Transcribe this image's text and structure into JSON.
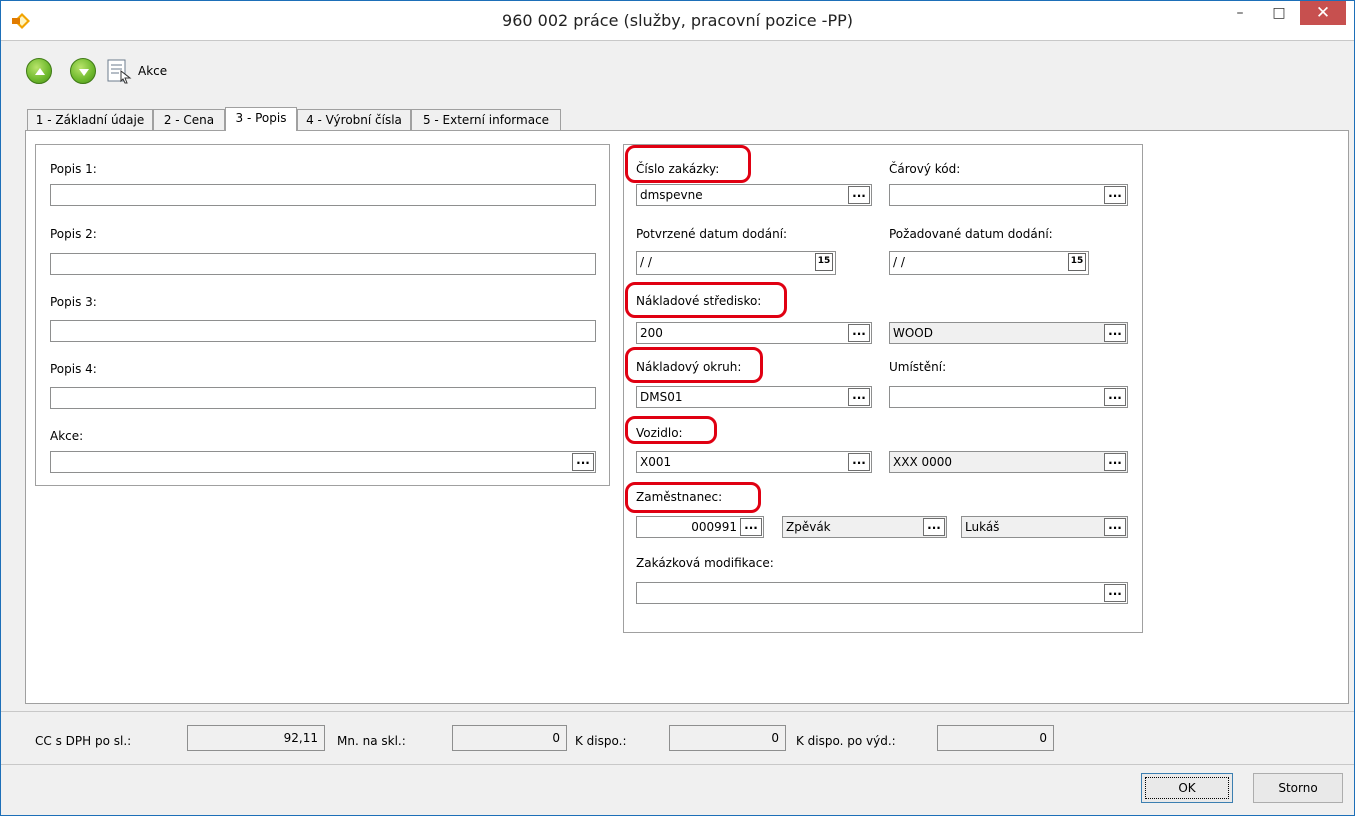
{
  "window": {
    "title": "960 002 práce (služby, pracovní pozice -PP)",
    "min_symbol": "–",
    "max_symbol": "□",
    "close_symbol": "✕",
    "accent": "#c7504f"
  },
  "toolbar": {
    "akce_label": "Akce"
  },
  "tabs": [
    {
      "label": "1 - Základní údaje"
    },
    {
      "label": "2 - Cena"
    },
    {
      "label": "3 - Popis"
    },
    {
      "label": "4 - Výrobní čísla"
    },
    {
      "label": "5 - Externí informace"
    }
  ],
  "left": {
    "popis1_label": "Popis 1:",
    "popis1_value": "",
    "popis2_label": "Popis 2:",
    "popis2_value": "",
    "popis3_label": "Popis 3:",
    "popis3_value": "",
    "popis4_label": "Popis 4:",
    "popis4_value": "",
    "akce_label": "Akce:",
    "akce_value": ""
  },
  "right": {
    "cislo_zakazky_label": "Číslo zakázky:",
    "cislo_zakazky_value": "dmspevne",
    "carovy_kod_label": "Čárový kód:",
    "carovy_kod_value": "",
    "potvrzene_label": "Potvrzené datum dodání:",
    "potvrzene_value": "/ /",
    "pozadovane_label": "Požadované datum dodání:",
    "pozadovane_value": "/ /",
    "calendar_glyph": "15",
    "stredisko_label": "Nákladové středisko:",
    "stredisko_value": "200",
    "stredisko_name": "WOOD",
    "okruh_label": "Nákladový okruh:",
    "okruh_value": "DMS01",
    "umisteni_label": "Umístění:",
    "umisteni_value": "",
    "vozidlo_label": "Vozidlo:",
    "vozidlo_value": "X001",
    "vozidlo_spz": "XXX 0000",
    "zamestnanec_label": "Zaměstnanec:",
    "zamestnanec_code": "000991",
    "zamestnanec_surname": "Zpěvák",
    "zamestnanec_firstname": "Lukáš",
    "modifikace_label": "Zakázková modifikace:",
    "modifikace_value": ""
  },
  "ellipsis": "...",
  "status": {
    "cc_label": "CC s DPH po sl.:",
    "cc_value": "92,11",
    "mn_label": "Mn. na skl.:",
    "mn_value": "0",
    "kdispo_label": "K dispo.:",
    "kdispo_value": "0",
    "kdispo_vyd_label": "K dispo. po výd.:",
    "kdispo_vyd_value": "0"
  },
  "buttons": {
    "ok": "OK",
    "storno": "Storno"
  }
}
